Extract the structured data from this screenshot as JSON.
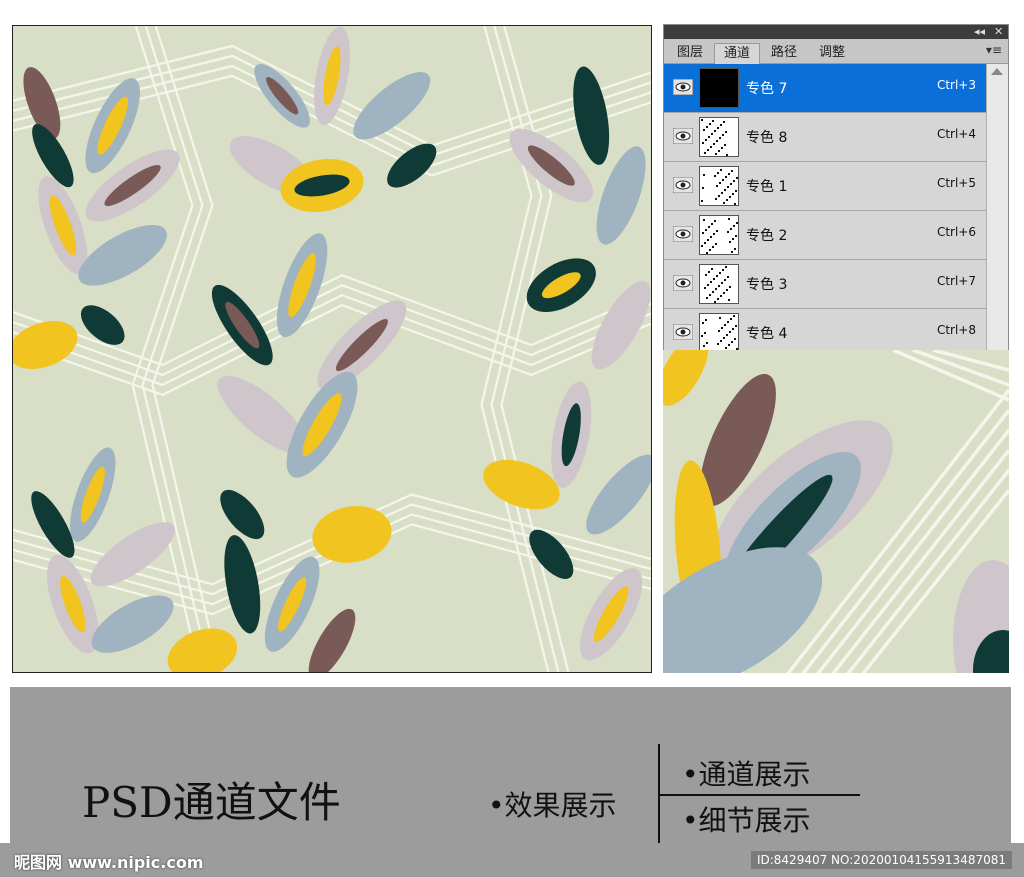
{
  "colors": {
    "background": "#d9dfc6",
    "white_lines": "#f4f6ec",
    "brown": "#7a5a56",
    "dark_teal": "#0f3a36",
    "yellow": "#f2c41f",
    "blue_grey": "#9fb3c0",
    "lilac": "#cfc6cb",
    "panel_selected": "#0a6fd8",
    "banner": "#9c9c9c"
  },
  "panel": {
    "titlebar": {
      "collapse_icon": "double-chevron-icon",
      "close_label": "✕",
      "collapse_label": "◂◂"
    },
    "tabs": [
      "图层",
      "通道",
      "路径",
      "调整"
    ],
    "active_tab": "通道",
    "menu_label": "▾≡",
    "channels": [
      {
        "name": "专色 7",
        "shortcut": "Ctrl+3",
        "selected": true
      },
      {
        "name": "专色 8",
        "shortcut": "Ctrl+4",
        "selected": false
      },
      {
        "name": "专色 1",
        "shortcut": "Ctrl+5",
        "selected": false
      },
      {
        "name": "专色 2",
        "shortcut": "Ctrl+6",
        "selected": false
      },
      {
        "name": "专色 3",
        "shortcut": "Ctrl+7",
        "selected": false
      },
      {
        "name": "专色 4",
        "shortcut": "Ctrl+8",
        "selected": false
      }
    ]
  },
  "banner": {
    "title": "PSD通道文件",
    "bullet_effect": "•效果展示",
    "bullet_channel": "•通道展示",
    "bullet_detail": "•细节展示"
  },
  "footer": {
    "site": "昵图网 www.nipic.com",
    "id_text": "ID:8429407 NO:20200104155913487081"
  }
}
